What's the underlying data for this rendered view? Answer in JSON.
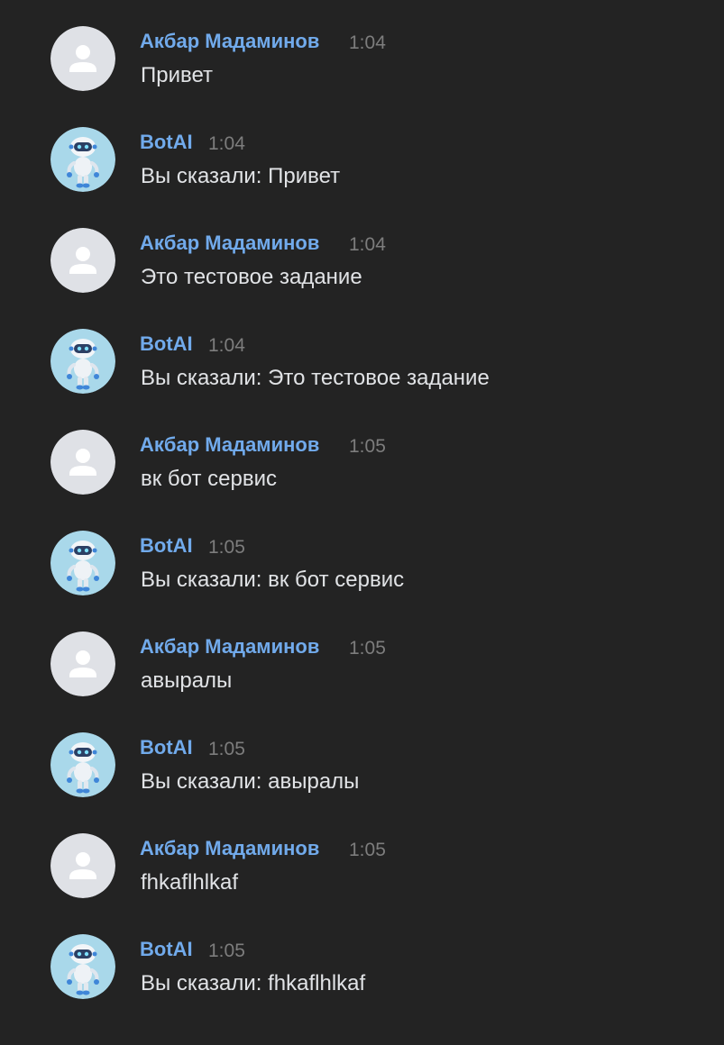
{
  "messages": [
    {
      "author": "Акбар Мадаминов",
      "time": "1:04",
      "text": "Привет",
      "avatar": "user-placeholder-icon"
    },
    {
      "author": "BotAI",
      "time": "1:04",
      "text": "Вы сказали: Привет",
      "avatar": "robot-icon"
    },
    {
      "author": "Акбар Мадаминов",
      "time": "1:04",
      "text": "Это тестовое задание",
      "avatar": "user-placeholder-icon"
    },
    {
      "author": "BotAI",
      "time": "1:04",
      "text": "Вы сказали: Это тестовое задание",
      "avatar": "robot-icon"
    },
    {
      "author": "Акбар Мадаминов",
      "time": "1:05",
      "text": "вк бот сервис",
      "avatar": "user-placeholder-icon"
    },
    {
      "author": "BotAI",
      "time": "1:05",
      "text": "Вы сказали: вк бот сервис",
      "avatar": "robot-icon"
    },
    {
      "author": "Акбар Мадаминов",
      "time": "1:05",
      "text": "авыралы",
      "avatar": "user-placeholder-icon"
    },
    {
      "author": "BotAI",
      "time": "1:05",
      "text": "Вы сказали: авыралы",
      "avatar": "robot-icon"
    },
    {
      "author": "Акбар Мадаминов",
      "time": "1:05",
      "text": "fhkaflhlkaf",
      "avatar": "user-placeholder-icon"
    },
    {
      "author": "BotAI",
      "time": "1:05",
      "text": "Вы сказали: fhkaflhlkaf",
      "avatar": "robot-icon"
    }
  ],
  "colors": {
    "background": "#232323",
    "author_name": "#71aaeb",
    "timestamp": "#7d7d7d",
    "message_text": "#e1e3e6",
    "user_avatar_bg": "#dfe1e6",
    "user_avatar_icon": "#ffffff",
    "bot_avatar_bg": "#a9d8ea"
  }
}
